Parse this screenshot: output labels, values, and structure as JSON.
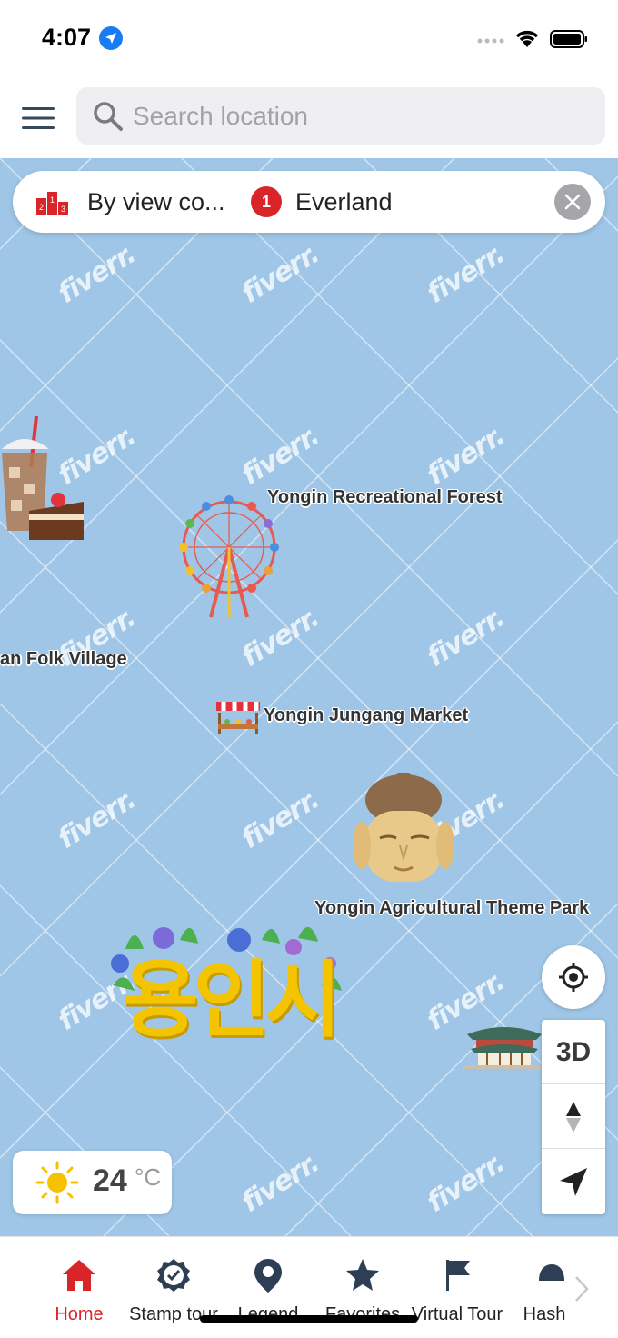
{
  "status_bar": {
    "time": "4:07"
  },
  "search": {
    "placeholder": "Search location"
  },
  "filter": {
    "sort_label": "By view co...",
    "rank": "1",
    "place": "Everland"
  },
  "map": {
    "poi_labels": [
      "Yongin Recreational Forest",
      "an Folk Village",
      "Yongin Jungang Market",
      "Yongin Agricultural Theme Park"
    ],
    "city_logo_text": "용인시",
    "watermark": "fiverr."
  },
  "controls": {
    "three_d_label": "3D"
  },
  "weather": {
    "temperature": "24",
    "unit": "°C"
  },
  "tabs": [
    {
      "label": "Home",
      "icon": "home-icon",
      "active": true
    },
    {
      "label": "Stamp tour",
      "icon": "stamp-badge-icon",
      "active": false
    },
    {
      "label": "Legend",
      "icon": "map-pin-icon",
      "active": false
    },
    {
      "label": "Favorites",
      "icon": "star-icon",
      "active": false
    },
    {
      "label": "Virtual Tour",
      "icon": "flag-icon",
      "active": false
    },
    {
      "label": "Hash",
      "icon": "hashtag-icon",
      "active": false
    }
  ],
  "colors": {
    "accent": "#d9252a",
    "map_water": "#9fc6e7",
    "text": "#222222"
  }
}
